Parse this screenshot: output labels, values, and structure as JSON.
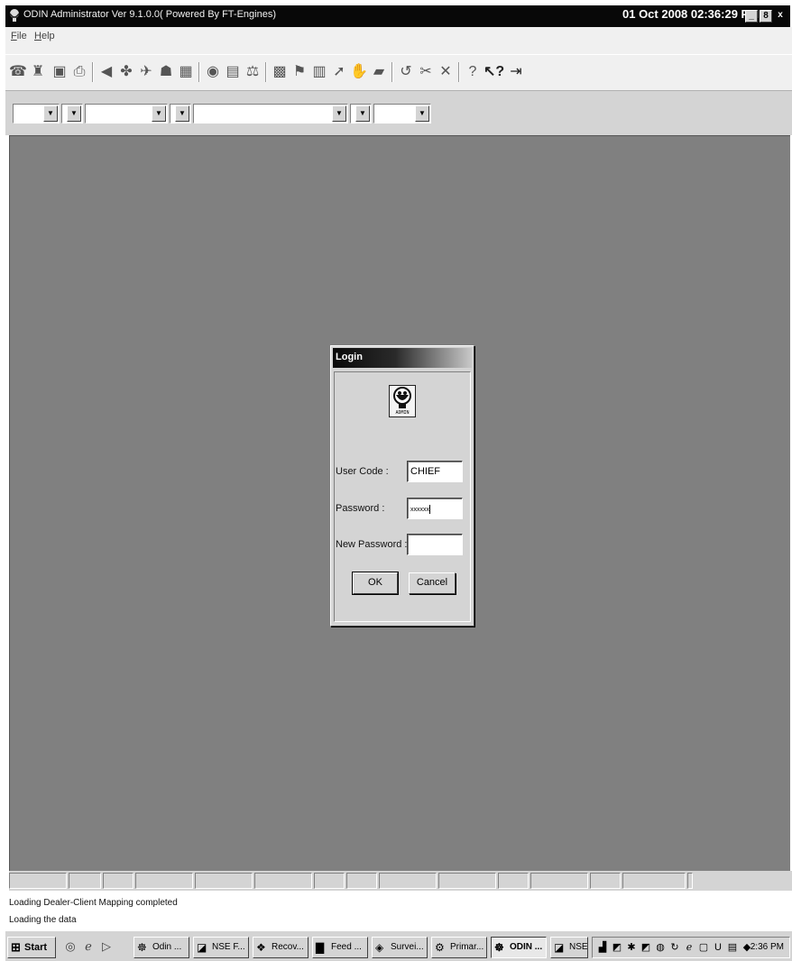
{
  "window": {
    "title": "ODIN Administrator Ver  9.1.0.0( Powered By  FT-Engines)",
    "datetime": "01 Oct 2008  02:36:29 PM",
    "controls": [
      "_",
      "8",
      "x"
    ]
  },
  "menu": {
    "items": [
      {
        "label": "File",
        "accel": "F",
        "rest": "ile"
      },
      {
        "label": "Help",
        "accel": "H",
        "rest": "elp"
      }
    ]
  },
  "toolbar": {
    "icons": [
      "phone-icon",
      "bell-icon",
      "save-icon",
      "print-icon",
      "speaker-icon",
      "tools-icon",
      "satellite-icon",
      "binoculars-icon",
      "calendar-icon",
      "disc-icon",
      "report-icon",
      "scales-icon",
      "chart-icon",
      "flag-icon",
      "chip-icon",
      "arrow-icon",
      "hand-icon",
      "lock-icon",
      "undo-icon",
      "cut-cross-icon",
      "close-cross-icon",
      "help-icon",
      "whats-this-icon",
      "exit-icon"
    ]
  },
  "combobar": {
    "combos": [
      "",
      "",
      "",
      "",
      "",
      "",
      ""
    ]
  },
  "login": {
    "title": "Login",
    "logo_text": "ADMIN",
    "user_code_label": "User Code :",
    "user_code_value": "CHIEF",
    "password_label": "Password :",
    "password_value": "xxxxxx",
    "new_password_label": "New Password :",
    "new_password_value": "",
    "ok_label": "OK",
    "cancel_label": "Cancel"
  },
  "status": {
    "line1": "Loading Dealer-Client Mapping completed",
    "line2": "Loading the data"
  },
  "taskbar": {
    "start_label": "Start",
    "tasks": [
      {
        "label": "Odin ...",
        "icon": "odin-icon",
        "active": false
      },
      {
        "label": "NSE F...",
        "icon": "nse-icon",
        "active": false
      },
      {
        "label": "Recov...",
        "icon": "recover-icon",
        "active": false
      },
      {
        "label": "Feed ...",
        "icon": "feed-icon",
        "active": false
      },
      {
        "label": "Survei...",
        "icon": "surveillance-icon",
        "active": false
      },
      {
        "label": "Primar...",
        "icon": "primary-icon",
        "active": false
      },
      {
        "label": "ODIN ...",
        "icon": "odin-admin-icon",
        "active": true
      },
      {
        "label": "NSE F...",
        "icon": "nse-icon",
        "active": false
      }
    ],
    "clock": "2:36 PM"
  }
}
